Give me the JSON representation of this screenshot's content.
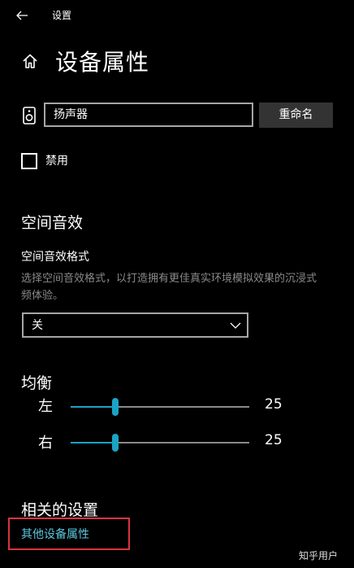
{
  "window": {
    "title": "设置",
    "back_icon": "back-arrow-icon"
  },
  "header": {
    "title": "设备属性",
    "icon": "home-icon"
  },
  "device": {
    "icon": "speaker-icon",
    "name_value": "扬声器",
    "rename_label": "重命名"
  },
  "disable": {
    "label": "禁用",
    "checked": false
  },
  "spatial_sound": {
    "heading": "空间音效",
    "format_label": "空间音效格式",
    "description_line1": "选择空间音效格式，以打造拥有更佳真实环境模拟效果的沉浸式",
    "description_line2": "频体验。",
    "selected_value": "关",
    "dropdown_icon": "chevron-down-icon"
  },
  "balance": {
    "heading": "均衡",
    "left": {
      "label": "左",
      "value": "25"
    },
    "right": {
      "label": "右",
      "value": "25"
    },
    "accent_color": "#1aa3c4"
  },
  "related": {
    "heading": "相关的设置",
    "link": "其他设备属性",
    "link_color": "#5ac8e0",
    "highlight_color": "#d9343f"
  },
  "watermark": "知乎用户"
}
